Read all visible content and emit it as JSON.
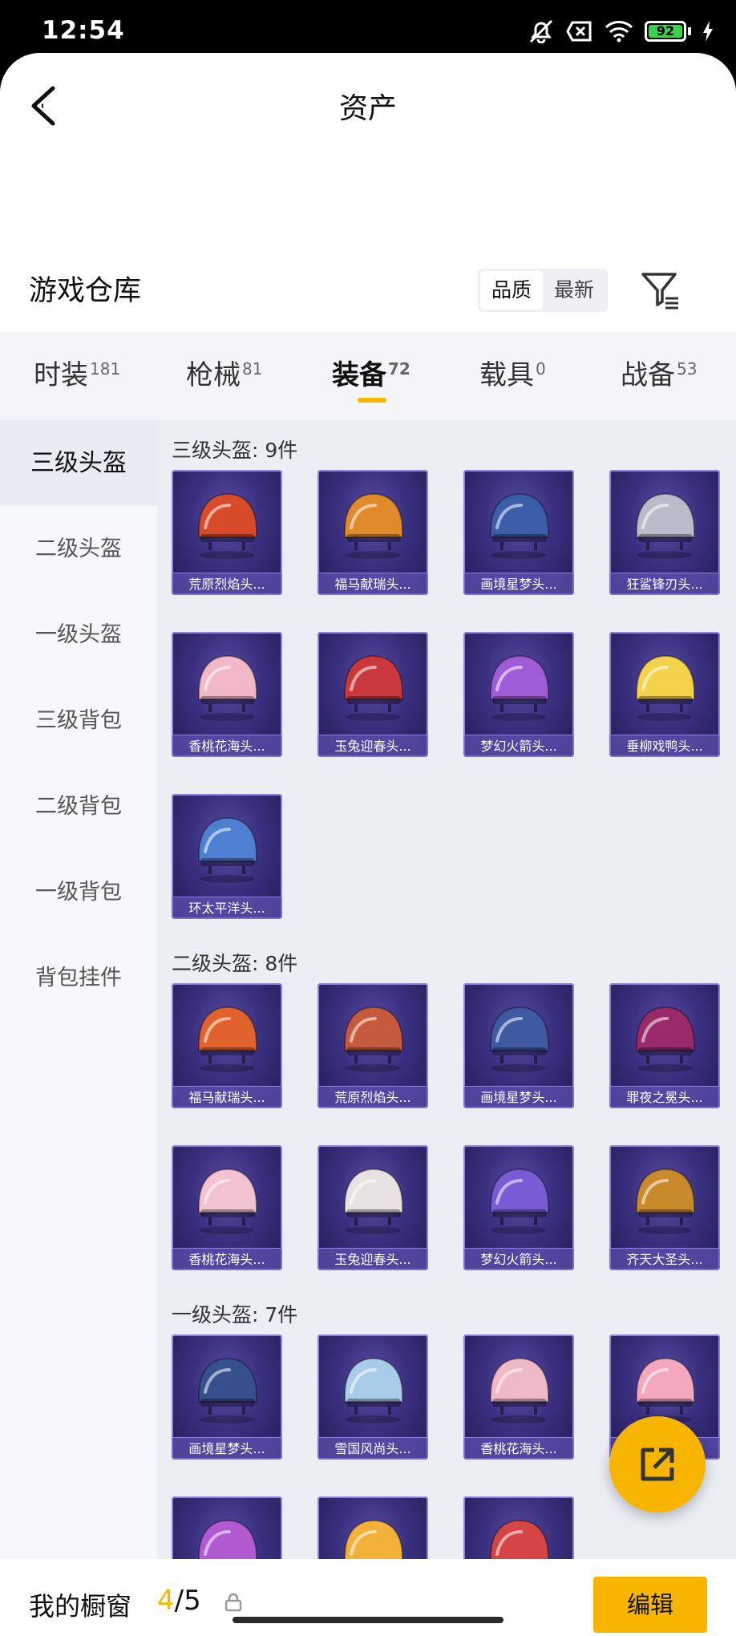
{
  "status_bar": {
    "time": "12:54",
    "battery": "92"
  },
  "header": {
    "title": "资产"
  },
  "section": {
    "title": "游戏仓库",
    "sort_options": [
      "品质",
      "最新"
    ]
  },
  "tabs": [
    {
      "label": "时装",
      "count": "181"
    },
    {
      "label": "枪械",
      "count": "81"
    },
    {
      "label": "装备",
      "count": "72"
    },
    {
      "label": "载具",
      "count": "0"
    },
    {
      "label": "战备",
      "count": "53"
    }
  ],
  "sidebar": [
    {
      "label": "三级头盔"
    },
    {
      "label": "二级头盔"
    },
    {
      "label": "一级头盔"
    },
    {
      "label": "三级背包"
    },
    {
      "label": "二级背包"
    },
    {
      "label": "一级背包"
    },
    {
      "label": "背包挂件"
    }
  ],
  "groups": [
    {
      "title": "三级头盔: 9件",
      "items": [
        {
          "name": "荒原烈焰头...",
          "color": "#d64b2a"
        },
        {
          "name": "福马献瑞头...",
          "color": "#e08a2b"
        },
        {
          "name": "画境星梦头...",
          "color": "#3a5fa8"
        },
        {
          "name": "狂鲨锋刃头...",
          "color": "#b8bcc8"
        },
        {
          "name": "香桃花海头...",
          "color": "#f1b8c8"
        },
        {
          "name": "玉兔迎春头...",
          "color": "#c8383c"
        },
        {
          "name": "梦幻火箭头...",
          "color": "#a05bd6"
        },
        {
          "name": "垂柳戏鸭头...",
          "color": "#f2d34a"
        },
        {
          "name": "环太平洋头...",
          "color": "#4f7fd0"
        }
      ]
    },
    {
      "title": "二级头盔: 8件",
      "items": [
        {
          "name": "福马献瑞头...",
          "color": "#e0632e"
        },
        {
          "name": "荒原烈焰头...",
          "color": "#c65a3c"
        },
        {
          "name": "画境星梦头...",
          "color": "#3f5aa0"
        },
        {
          "name": "罪夜之冕头...",
          "color": "#9a2a6a"
        },
        {
          "name": "香桃花海头...",
          "color": "#f3c2d0"
        },
        {
          "name": "玉兔迎春头...",
          "color": "#e8e2e2"
        },
        {
          "name": "梦幻火箭头...",
          "color": "#7a5bd6"
        },
        {
          "name": "齐天大圣头...",
          "color": "#c88a2a"
        }
      ]
    },
    {
      "title": "一级头盔: 7件",
      "items": [
        {
          "name": "画境星梦头...",
          "color": "#36508e"
        },
        {
          "name": "雪国风尚头...",
          "color": "#a9cde8"
        },
        {
          "name": "香桃花海头...",
          "color": "#f0b9c6"
        },
        {
          "name": "",
          "color": "#f3a8bd"
        },
        {
          "name": "",
          "color": "#b15ad2"
        },
        {
          "name": "",
          "color": "#f2b23a"
        },
        {
          "name": "",
          "color": "#d64545"
        }
      ]
    }
  ],
  "showcase": {
    "label": "我的橱窗",
    "current": "4",
    "total": "/5",
    "edit_label": "编辑"
  }
}
